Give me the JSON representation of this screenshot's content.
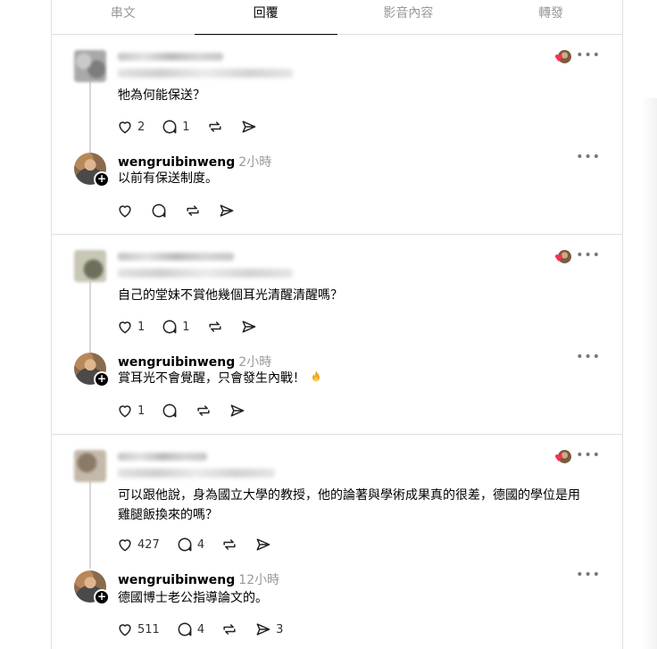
{
  "tabs": [
    {
      "label": "串文",
      "active": false
    },
    {
      "label": "回覆",
      "active": true
    },
    {
      "label": "影音內容",
      "active": false
    },
    {
      "label": "轉發",
      "active": false
    }
  ],
  "threads": [
    {
      "comment": {
        "text": "牠為何能保送？",
        "likes": "2",
        "replies": "1",
        "reposts": "",
        "shares": ""
      },
      "reply": {
        "username": "wengruibinweng",
        "time": "2小時",
        "text": "以前有保送制度。",
        "likes": "",
        "replies": "",
        "reposts": "",
        "shares": ""
      }
    },
    {
      "comment": {
        "text": "自己的堂妹不賞他幾個耳光清醒清醒嗎？",
        "likes": "1",
        "replies": "1",
        "reposts": "",
        "shares": ""
      },
      "reply": {
        "username": "wengruibinweng",
        "time": "2小時",
        "text": "賞耳光不會覺醒，只會發生內戰！",
        "likes": "1",
        "replies": "",
        "reposts": "",
        "shares": ""
      }
    },
    {
      "comment": {
        "text": "可以跟他說，身為國立大學的教授，他的論著與學術成果真的很差，德國的學位是用雞腿飯換來的嗎？",
        "likes": "427",
        "replies": "4",
        "reposts": "",
        "shares": ""
      },
      "reply": {
        "username": "wengruibinweng",
        "time": "12小時",
        "text": "德國博士老公指導論文的。",
        "likes": "511",
        "replies": "4",
        "reposts": "",
        "shares": "3"
      }
    }
  ],
  "more_label": "•••",
  "plus_label": "+",
  "heart_glyph": "♥",
  "colors": {
    "heart": "#ff2d55",
    "divider": "#e0e0e0",
    "muted": "#999999"
  }
}
